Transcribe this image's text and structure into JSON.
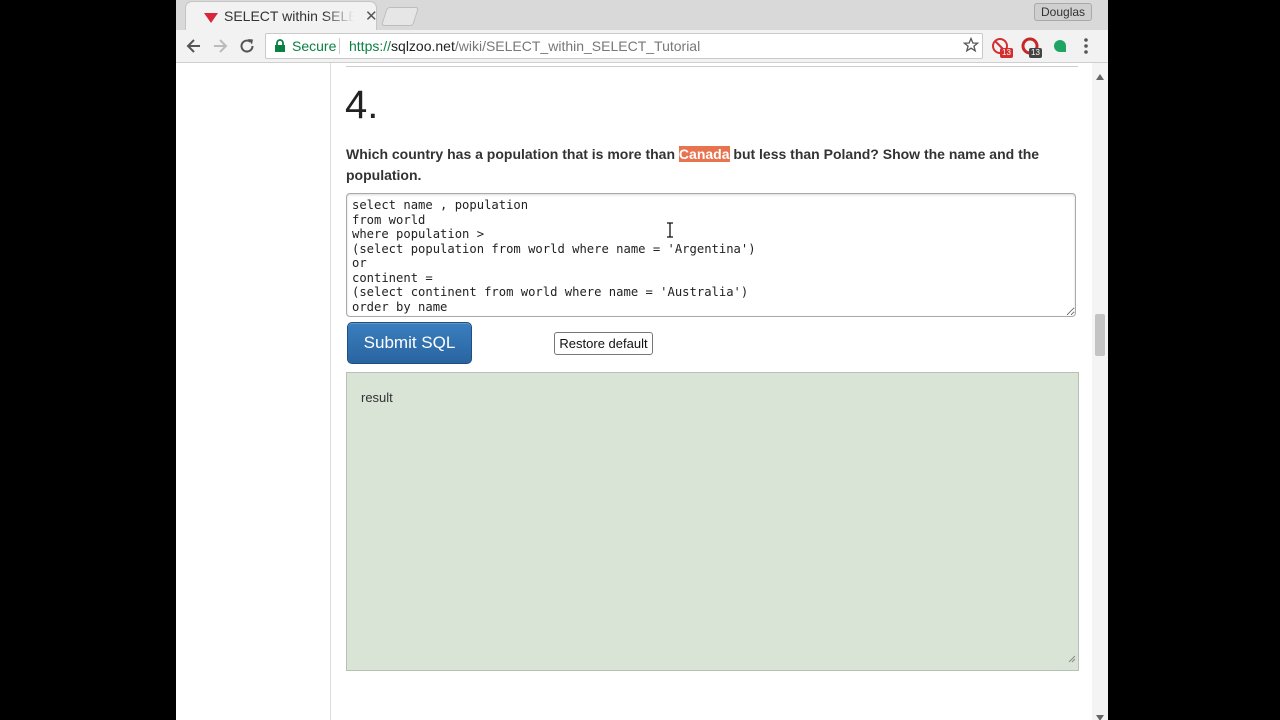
{
  "browser": {
    "tab_title": "SELECT within SELECT Tutorial",
    "profile_name": "Douglas",
    "secure_label": "Secure",
    "url_scheme": "https://",
    "url_domain": "sqlzoo.net",
    "url_path": "/wiki/SELECT_within_SELECT_Tutorial",
    "extension_badge_1": "13",
    "extension_badge_2": "13",
    "accent_color": "#0b8043"
  },
  "question": {
    "number": "4.",
    "text_before": "Which country has a population that is more than ",
    "highlighted": "Canada",
    "text_after": " but less than Poland? Show the name and the population."
  },
  "editor": {
    "sql": "select name , population\nfrom world\nwhere population >\n(select population from world where name = 'Argentina')\nor\ncontinent =\n(select continent from world where name = 'Australia')\norder by name"
  },
  "buttons": {
    "submit_label": "Submit SQL",
    "restore_label": "Restore default"
  },
  "result": {
    "label": "result"
  }
}
